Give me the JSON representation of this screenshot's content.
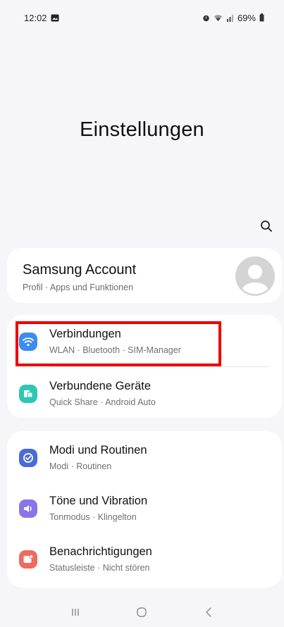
{
  "status_bar": {
    "time": "12:02",
    "battery": "69%"
  },
  "page": {
    "title": "Einstellungen"
  },
  "account": {
    "title": "Samsung Account",
    "subtitle": "Profil · Apps und Funktionen"
  },
  "groups": [
    {
      "items": [
        {
          "title": "Verbindungen",
          "subtitle": "WLAN · Bluetooth · SIM-Manager",
          "icon": "wifi-icon",
          "color": "#3d8df0"
        },
        {
          "title": "Verbundene Geräte",
          "subtitle": "Quick Share · Android Auto",
          "icon": "devices-icon",
          "color": "#2ec7b3"
        }
      ]
    },
    {
      "items": [
        {
          "title": "Modi und Routinen",
          "subtitle": "Modi · Routinen",
          "icon": "modes-icon",
          "color": "#4a6bd8"
        },
        {
          "title": "Töne und Vibration",
          "subtitle": "Tonmodus · Klingelton",
          "icon": "sound-icon",
          "color": "#8a74e8"
        },
        {
          "title": "Benachrichtigungen",
          "subtitle": "Statusleiste · Nicht stören",
          "icon": "notification-icon",
          "color": "#f06b5e"
        }
      ]
    }
  ],
  "highlight_color": "#ee0000"
}
